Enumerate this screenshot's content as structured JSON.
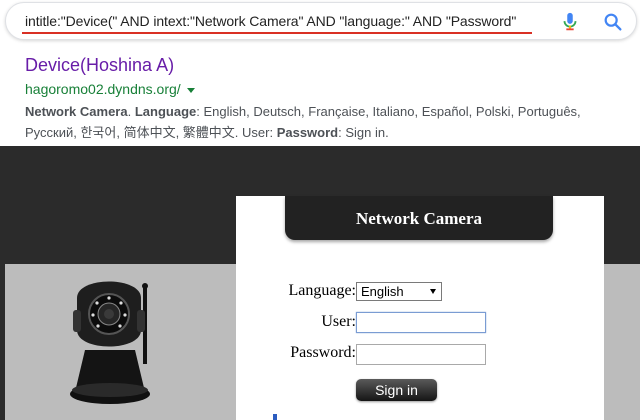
{
  "search": {
    "query": "intitle:\"Device(\" AND intext:\"Network Camera\" AND \"language:\" AND \"Password\""
  },
  "result": {
    "title": "Device(Hoshina A)",
    "url": "hagoromo02.dyndns.org/",
    "snippet": {
      "t1": "Network Camera",
      "t2": ". ",
      "t3": "Language",
      "t4": ": English, Deutsch, Française, Italiano, Español, Polski, Português, Русский, 한국어, 简体中文, 繁體中文. User: ",
      "t5": "Password",
      "t6": ": Sign in."
    }
  },
  "camera_page": {
    "header_title": "Network Camera",
    "language_label": "Language:",
    "language_value": "English",
    "user_label": "User:",
    "password_label": "Password:",
    "signin_label": "Sign in"
  },
  "icons": {
    "mic": "microphone-icon",
    "search": "magnifier-icon",
    "url_menu": "triangle-down-icon"
  },
  "colors": {
    "visited_link": "#681da8",
    "url_green": "#188038",
    "highlight_red": "#d93025",
    "dark_bg": "#2b2b2b"
  }
}
